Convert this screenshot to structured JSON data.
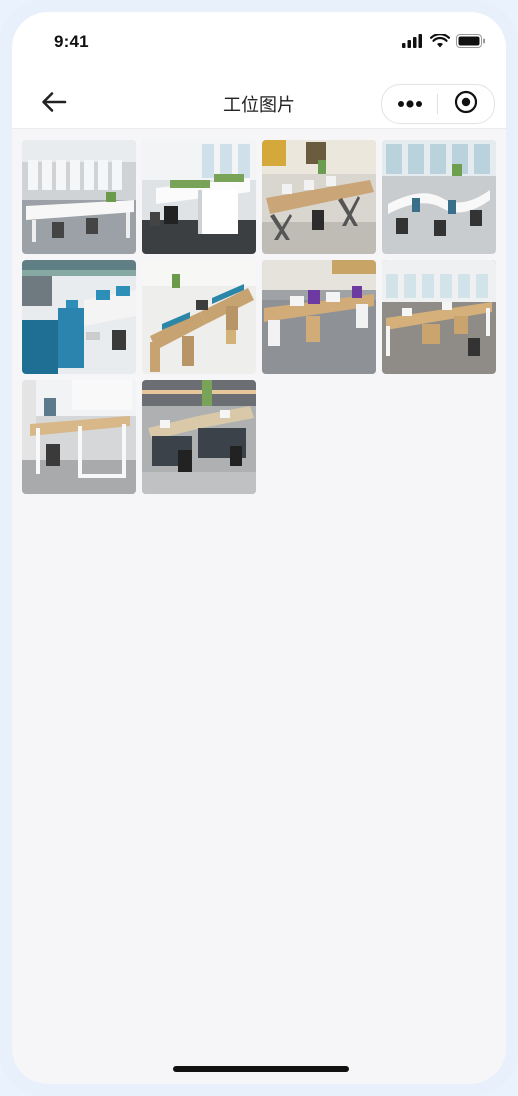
{
  "status_bar": {
    "time": "9:41",
    "icons": [
      "signal-icon",
      "wifi-icon",
      "battery-icon"
    ]
  },
  "nav": {
    "title": "工位图片",
    "back_icon": "arrow-left-icon",
    "more_icon": "more-dots-icon",
    "close_icon": "target-circle-icon"
  },
  "gallery": {
    "image_count": 10
  },
  "colors": {
    "screen_bg": "#f6f6f9",
    "header_bg": "#ffffff",
    "frame": "#e8f0fc"
  }
}
